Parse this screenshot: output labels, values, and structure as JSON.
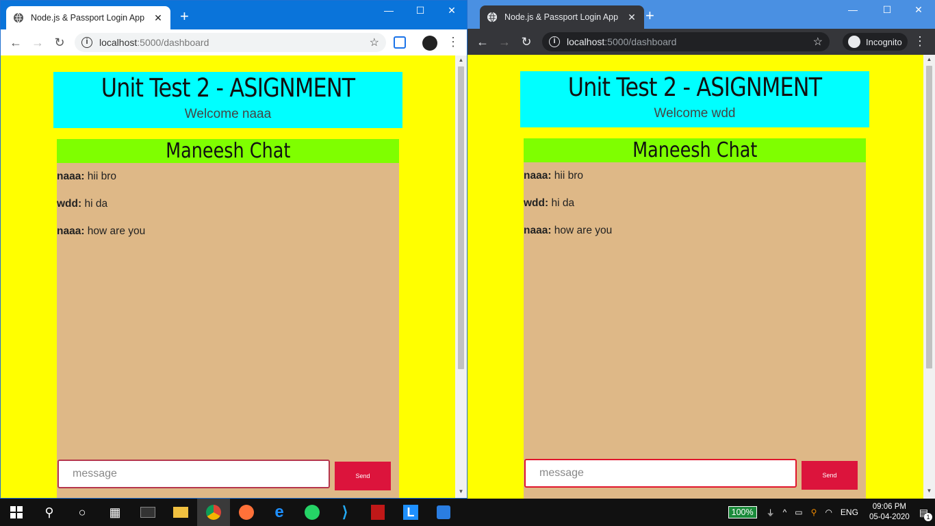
{
  "left": {
    "tab_title": "Node.js & Passport Login App",
    "url_host": "localhost",
    "url_path": ":5000/dashboard",
    "header_title": "Unit Test 2 - ASIGNMENT",
    "welcome": "Welcome naaa",
    "chat_title": "Maneesh Chat",
    "messages": [
      {
        "user": "naaa:",
        "text": " hii bro"
      },
      {
        "user": "wdd:",
        "text": " hi da"
      },
      {
        "user": "naaa:",
        "text": " how are you"
      }
    ],
    "input_placeholder": "message",
    "send_label": "Send"
  },
  "right": {
    "tab_title": "Node.js & Passport Login App",
    "url_host": "localhost",
    "url_path": ":5000/dashboard",
    "incognito_label": "Incognito",
    "header_title": "Unit Test 2 - ASIGNMENT",
    "welcome": "Welcome wdd",
    "chat_title": "Maneesh Chat",
    "messages": [
      {
        "user": "naaa:",
        "text": " hii bro"
      },
      {
        "user": "wdd:",
        "text": " hi da"
      },
      {
        "user": "naaa:",
        "text": " how are you"
      }
    ],
    "input_placeholder": "message",
    "send_label": "Send"
  },
  "taskbar": {
    "battery": "100%",
    "lang": "ENG",
    "time": "09:06 PM",
    "date": "05-04-2020",
    "notifications": "1"
  },
  "colors": {
    "page_bg": "#ffff00",
    "header_bg": "#00ffff",
    "chat_title_bg": "#7fff00",
    "chat_bg": "#deb887",
    "send_bg": "#dc143c"
  }
}
